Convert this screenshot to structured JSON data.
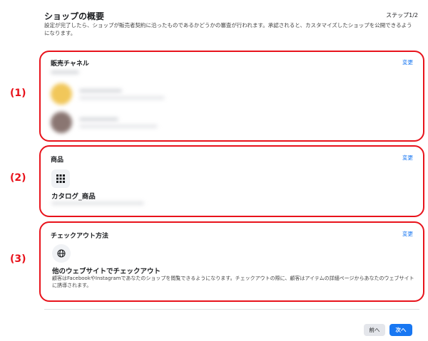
{
  "header": {
    "title": "ショップの概要",
    "step": "ステップ1/2",
    "description": "設定が完了したら、ショップが販売者契約に沿ったものであるかどうかの審査が行われます。承認されると、カスタマイズしたショップを公開できるようになります。"
  },
  "callouts": [
    "(1)",
    "(2)",
    "(3)"
  ],
  "sections": [
    {
      "title": "販売チャネル",
      "change_label": "変更"
    },
    {
      "title": "商品",
      "change_label": "変更",
      "icon": "grid-icon",
      "item_name": "カタログ_商品"
    },
    {
      "title": "チェックアウト方法",
      "change_label": "変更",
      "icon": "globe-icon",
      "method_title": "他のウェブサイトでチェックアウト",
      "method_desc": "顧客はFacebookやInstagramであなたのショップを閲覧できるようになります。チェックアウトの際に、顧客はアイテムの詳細ページからあなたのウェブサイトに誘導されます。"
    }
  ],
  "footer": {
    "prev_label": "前へ",
    "next_label": "次へ"
  },
  "colors": {
    "accent": "#1877f2",
    "callout": "#e8121b"
  }
}
